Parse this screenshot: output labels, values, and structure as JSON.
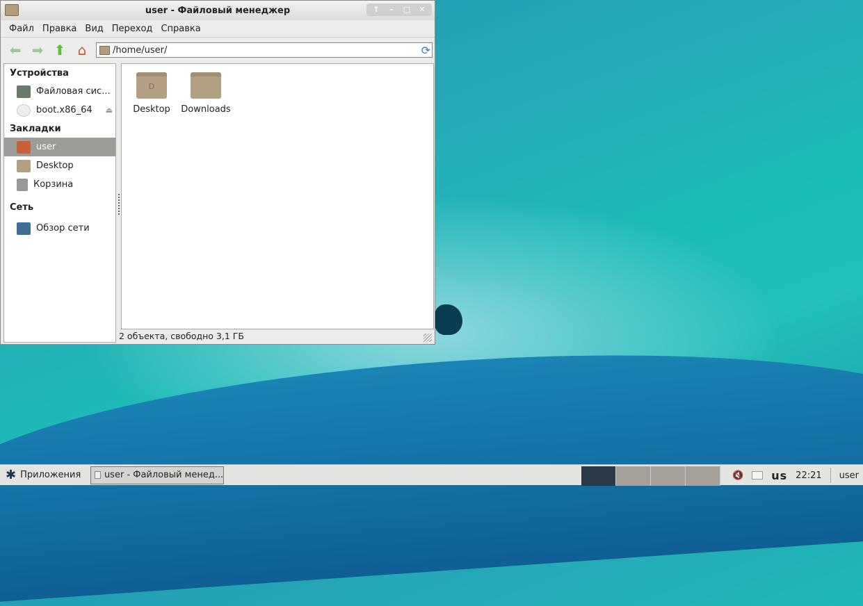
{
  "window": {
    "title": "user - Файловый менеджер",
    "controls": [
      "↑",
      "–",
      "□",
      "✕"
    ]
  },
  "menu": [
    "Файл",
    "Правка",
    "Вид",
    "Переход",
    "Справка"
  ],
  "address": "/home/user/",
  "sidebar": {
    "devices_title": "Устройства",
    "devices": [
      {
        "label": "Файловая сис..."
      },
      {
        "label": "boot.x86_64"
      }
    ],
    "bookmarks_title": "Закладки",
    "bookmarks": [
      {
        "label": "user"
      },
      {
        "label": "Desktop"
      },
      {
        "label": "Корзина"
      }
    ],
    "network_title": "Сеть",
    "network": [
      {
        "label": "Обзор сети"
      }
    ]
  },
  "files": [
    {
      "name": "Desktop"
    },
    {
      "name": "Downloads"
    }
  ],
  "status": "2 объекта, свободно 3,1 ГБ",
  "taskbar": {
    "start": "Приложения",
    "task": "user - Файловый менед...",
    "layout": "us",
    "clock": "22:21",
    "user": "user"
  }
}
